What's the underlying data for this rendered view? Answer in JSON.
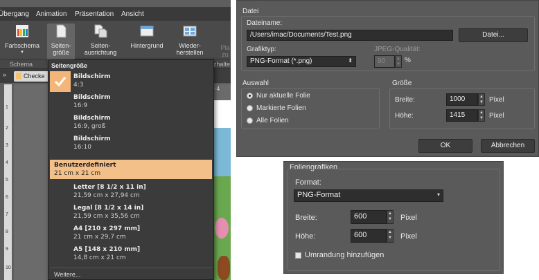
{
  "ribbon": {
    "menu": [
      "Übergang",
      "Animation",
      "Präsentation",
      "Ansicht"
    ],
    "buttons": {
      "farbschema": "Farbschema",
      "seitengroesse_1": "Seiten-",
      "seitengroesse_2": "größe",
      "seitenausrichtung_1": "Seiten-",
      "seitenausrichtung_2": "ausrichtung",
      "hintergrund": "Hintergrund",
      "wiederherstellen_1": "Wieder-",
      "wiederherstellen_2": "herstellen",
      "partial_1": "Pla",
      "partial_2": "zu"
    },
    "section_schema": "Schema",
    "section_partial": "zhalte",
    "doc_tab": "Checke",
    "ruler_partial": "·4"
  },
  "dropdown": {
    "header": "Seitengröße",
    "items": [
      {
        "title": "Bildschirm",
        "sub": "4:3"
      },
      {
        "title": "Bildschirm",
        "sub": "16:9"
      },
      {
        "title": "Bildschirm",
        "sub": "16:9, groß"
      },
      {
        "title": "Bildschirm",
        "sub": "16:10"
      },
      {
        "title": "Benutzerdefiniert",
        "sub": "21 cm x 21 cm"
      },
      {
        "title": "Letter [8 1/2 x 11 in]",
        "sub": "21,59 cm x 27,94 cm"
      },
      {
        "title": "Legal [8 1/2 x 14 in]",
        "sub": "21,59 cm x 35,56 cm"
      },
      {
        "title": "A4 [210 x 297 mm]",
        "sub": "21 cm x 29,7 cm"
      },
      {
        "title": "A5 [148 x 210 mm]",
        "sub": "14,8 cm x 21 cm"
      }
    ],
    "more": "Weitere..."
  },
  "export": {
    "group_datei": "Datei",
    "dateiname_label": "Dateiname:",
    "dateiname_value": "/Users/imac/Documents/Test.png",
    "datei_button": "Datei...",
    "grafiktyp_label": "Grafiktyp:",
    "grafiktyp_value": "PNG-Format (*.png)",
    "jpeg_label": "JPEG-Qualität:",
    "jpeg_value": "90",
    "jpeg_unit": "%",
    "auswahl_label": "Auswahl",
    "radio_1": "Nur aktuelle Folie",
    "radio_2": "Markierte Folien",
    "radio_3": "Alle Folien",
    "groesse_label": "Größe",
    "breite_label": "Breite:",
    "breite_value": "1000",
    "hoehe_label": "Höhe:",
    "hoehe_value": "1415",
    "unit": "Pixel",
    "ok": "OK",
    "cancel": "Abbrechen"
  },
  "folien": {
    "title": "Foliengrafiken",
    "format_label": "Format:",
    "format_value": "PNG-Format",
    "breite_label": "Breite:",
    "breite_value": "600",
    "hoehe_label": "Höhe:",
    "hoehe_value": "600",
    "unit": "Pixel",
    "checkbox": "Umrandung hinzufügen"
  },
  "colors": {
    "highlight": "#f4c08a",
    "dialog_bg": "#5a5a5a"
  }
}
